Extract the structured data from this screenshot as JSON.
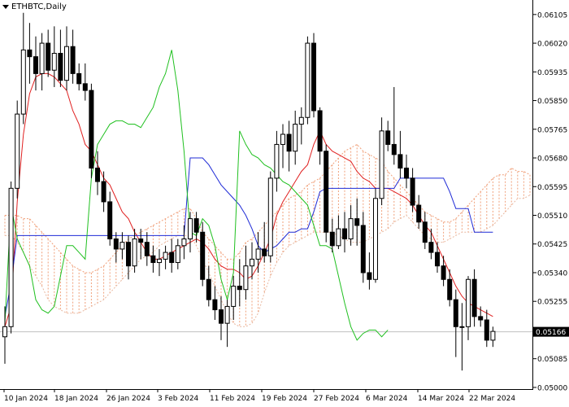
{
  "window": {
    "symbol": "ETHBTC",
    "timeframe": "Daily",
    "title": "ETHBTC,Daily",
    "menu_icon": "triangle-down-icon"
  },
  "colors": {
    "background": "#ffffff",
    "candle_up": "#ffffff",
    "candle_down": "#000000",
    "wick": "#000000",
    "tenkan": "#e02020",
    "kijun": "#1f2bd6",
    "chikou": "#20c020",
    "cloud_a": "#f0a07a",
    "cloud_b": "#e8b8a0",
    "price_line": "#c0c0c0"
  },
  "chart_data": {
    "type": "candlestick",
    "indicator": "Ichimoku Kinko Hyo",
    "y_ticks": [
      "0.06105",
      "0.06020",
      "0.05935",
      "0.05850",
      "0.05765",
      "0.05680",
      "0.05595",
      "0.05510",
      "0.05425",
      "0.05340",
      "0.05255",
      "0.05170",
      "0.05085",
      "0.05000"
    ],
    "x_ticks": [
      "10 Jan 2024",
      "18 Jan 2024",
      "26 Jan 2024",
      "3 Feb 2024",
      "11 Feb 2024",
      "19 Feb 2024",
      "27 Feb 2024",
      "6 Mar 2024",
      "14 Mar 2024",
      "22 Mar 2024"
    ],
    "ylim": [
      0.04995,
      0.06148
    ],
    "current_price": "0.05166",
    "candles": [
      [
        0.0515,
        0.0524,
        0.0507,
        0.0518
      ],
      [
        0.0518,
        0.0561,
        0.0516,
        0.0559
      ],
      [
        0.0559,
        0.0585,
        0.0556,
        0.0581
      ],
      [
        0.0581,
        0.0611,
        0.0578,
        0.06
      ],
      [
        0.06,
        0.0608,
        0.059,
        0.0598
      ],
      [
        0.0598,
        0.0604,
        0.0588,
        0.0593
      ],
      [
        0.0593,
        0.0605,
        0.0588,
        0.0602
      ],
      [
        0.0602,
        0.0606,
        0.0592,
        0.0594
      ],
      [
        0.0594,
        0.0607,
        0.0589,
        0.0599
      ],
      [
        0.0599,
        0.0606,
        0.0589,
        0.0591
      ],
      [
        0.0591,
        0.0607,
        0.0588,
        0.0601
      ],
      [
        0.0601,
        0.0606,
        0.059,
        0.0593
      ],
      [
        0.0593,
        0.0596,
        0.0588,
        0.059
      ],
      [
        0.059,
        0.0596,
        0.0585,
        0.0588
      ],
      [
        0.0588,
        0.059,
        0.0562,
        0.0565
      ],
      [
        0.0565,
        0.057,
        0.0557,
        0.0561
      ],
      [
        0.0561,
        0.0564,
        0.0552,
        0.0555
      ],
      [
        0.0555,
        0.0558,
        0.0542,
        0.0544
      ],
      [
        0.0544,
        0.0546,
        0.0537,
        0.0541
      ],
      [
        0.0541,
        0.0546,
        0.0538,
        0.0543
      ],
      [
        0.0543,
        0.0545,
        0.0532,
        0.0536
      ],
      [
        0.0536,
        0.0547,
        0.0534,
        0.0544
      ],
      [
        0.0544,
        0.0547,
        0.0538,
        0.0543
      ],
      [
        0.0543,
        0.0546,
        0.0536,
        0.0539
      ],
      [
        0.0539,
        0.0542,
        0.0534,
        0.0537
      ],
      [
        0.0537,
        0.0541,
        0.0533,
        0.0538
      ],
      [
        0.0538,
        0.0542,
        0.0535,
        0.054
      ],
      [
        0.054,
        0.0544,
        0.0534,
        0.0537
      ],
      [
        0.0537,
        0.0544,
        0.0535,
        0.0542
      ],
      [
        0.0542,
        0.0548,
        0.0538,
        0.0544
      ],
      [
        0.0544,
        0.0552,
        0.054,
        0.055
      ],
      [
        0.055,
        0.0552,
        0.0543,
        0.0546
      ],
      [
        0.0546,
        0.0549,
        0.053,
        0.0532
      ],
      [
        0.0532,
        0.0536,
        0.0524,
        0.0526
      ],
      [
        0.0526,
        0.053,
        0.052,
        0.0523
      ],
      [
        0.0523,
        0.0527,
        0.0514,
        0.0519
      ],
      [
        0.0519,
        0.0526,
        0.0512,
        0.0524
      ],
      [
        0.0524,
        0.0533,
        0.052,
        0.053
      ],
      [
        0.053,
        0.0538,
        0.0524,
        0.0529
      ],
      [
        0.0529,
        0.0542,
        0.0526,
        0.0536
      ],
      [
        0.0536,
        0.0543,
        0.0532,
        0.0538
      ],
      [
        0.0538,
        0.0546,
        0.0534,
        0.0541
      ],
      [
        0.0541,
        0.0549,
        0.0537,
        0.0539
      ],
      [
        0.0539,
        0.0564,
        0.0537,
        0.0562
      ],
      [
        0.0562,
        0.0576,
        0.0558,
        0.0572
      ],
      [
        0.0572,
        0.0578,
        0.0565,
        0.0575
      ],
      [
        0.0575,
        0.0579,
        0.0564,
        0.057
      ],
      [
        0.057,
        0.0582,
        0.0566,
        0.0578
      ],
      [
        0.0578,
        0.0583,
        0.0572,
        0.058
      ],
      [
        0.058,
        0.0604,
        0.0578,
        0.0602
      ],
      [
        0.0602,
        0.0605,
        0.058,
        0.0582
      ],
      [
        0.0582,
        0.0583,
        0.0566,
        0.057
      ],
      [
        0.057,
        0.0572,
        0.0543,
        0.0546
      ],
      [
        0.0546,
        0.055,
        0.054,
        0.0542
      ],
      [
        0.0542,
        0.0551,
        0.0541,
        0.0547
      ],
      [
        0.0547,
        0.0552,
        0.054,
        0.0544
      ],
      [
        0.0544,
        0.0554,
        0.0542,
        0.055
      ],
      [
        0.055,
        0.0556,
        0.0542,
        0.0548
      ],
      [
        0.0548,
        0.0552,
        0.0531,
        0.0534
      ],
      [
        0.0534,
        0.054,
        0.0529,
        0.0532
      ],
      [
        0.0532,
        0.0559,
        0.0531,
        0.0556
      ],
      [
        0.0556,
        0.058,
        0.0554,
        0.0576
      ],
      [
        0.0576,
        0.0579,
        0.057,
        0.0572
      ],
      [
        0.0572,
        0.0589,
        0.0566,
        0.0569
      ],
      [
        0.0569,
        0.0576,
        0.0562,
        0.0565
      ],
      [
        0.0565,
        0.0569,
        0.0559,
        0.0562
      ],
      [
        0.0562,
        0.0565,
        0.0552,
        0.0554
      ],
      [
        0.0554,
        0.0557,
        0.0547,
        0.0549
      ],
      [
        0.0549,
        0.0552,
        0.0541,
        0.0543
      ],
      [
        0.0543,
        0.0547,
        0.0538,
        0.054
      ],
      [
        0.054,
        0.0543,
        0.0534,
        0.0536
      ],
      [
        0.0536,
        0.0539,
        0.053,
        0.0532
      ],
      [
        0.0532,
        0.0535,
        0.0524,
        0.0526
      ],
      [
        0.0526,
        0.0529,
        0.0509,
        0.0518
      ],
      [
        0.0518,
        0.0525,
        0.0505,
        0.0518
      ],
      [
        0.0518,
        0.0533,
        0.0514,
        0.0532
      ],
      [
        0.0532,
        0.0535,
        0.0518,
        0.0521
      ],
      [
        0.0521,
        0.0524,
        0.0518,
        0.052
      ],
      [
        0.052,
        0.0523,
        0.0512,
        0.0514
      ],
      [
        0.0514,
        0.0518,
        0.0512,
        0.05166
      ]
    ],
    "tenkan": [
      0.0518,
      0.0524,
      0.0555,
      0.0575,
      0.0587,
      0.0592,
      0.0593,
      0.0593,
      0.0592,
      0.059,
      0.0588,
      0.0582,
      0.0578,
      0.0572,
      0.057,
      0.0566,
      0.0562,
      0.056,
      0.0556,
      0.0552,
      0.055,
      0.0546,
      0.0543,
      0.054,
      0.0538,
      0.0538,
      0.0539,
      0.054,
      0.0541,
      0.0542,
      0.0543,
      0.0544,
      0.0543,
      0.0541,
      0.0538,
      0.0536,
      0.0535,
      0.0535,
      0.0534,
      0.0532,
      0.0533,
      0.0536,
      0.054,
      0.0544,
      0.0551,
      0.0555,
      0.0558,
      0.0561,
      0.0564,
      0.0566,
      0.0572,
      0.0576,
      0.0572,
      0.057,
      0.0569,
      0.0568,
      0.0567,
      0.0564,
      0.0562,
      0.0561,
      0.0559,
      0.0559,
      0.0559,
      0.0558,
      0.0557,
      0.0556,
      0.0554,
      0.0551,
      0.0548,
      0.0546,
      0.0542,
      0.0538,
      0.0534,
      0.053,
      0.0527,
      0.0525,
      0.0524,
      0.0523,
      0.0522,
      0.0521
    ],
    "kijun": [
      0.0521,
      0.0531,
      0.0545,
      0.0545,
      0.0545,
      0.0545,
      0.0545,
      0.0545,
      0.0545,
      0.0545,
      0.0545,
      0.0545,
      0.0545,
      0.0545,
      0.0545,
      0.0545,
      0.0545,
      0.0545,
      0.0545,
      0.0545,
      0.0545,
      0.0545,
      0.0545,
      0.0545,
      0.0545,
      0.0545,
      0.0545,
      0.0545,
      0.0545,
      0.0545,
      0.0568,
      0.0568,
      0.0568,
      0.0566,
      0.0563,
      0.056,
      0.0558,
      0.0556,
      0.0554,
      0.0551,
      0.0547,
      0.0542,
      0.054,
      0.0541,
      0.0542,
      0.0544,
      0.0546,
      0.0546,
      0.0547,
      0.0547,
      0.0552,
      0.0558,
      0.0559,
      0.0559,
      0.0559,
      0.0559,
      0.0559,
      0.0559,
      0.0559,
      0.0559,
      0.0559,
      0.0559,
      0.0559,
      0.0559,
      0.0562,
      0.0562,
      0.0562,
      0.0562,
      0.0562,
      0.0562,
      0.0562,
      0.0562,
      0.0558,
      0.0553,
      0.0553,
      0.0553,
      0.0546,
      0.0546,
      0.0546,
      0.0546
    ],
    "chikou": [
      0.0519,
      0.0554,
      0.0544,
      0.054,
      0.0536,
      0.0526,
      0.0523,
      0.0522,
      0.0524,
      0.0533,
      0.0542,
      0.0542,
      0.054,
      0.0538,
      0.0562,
      0.0572,
      0.0575,
      0.0578,
      0.0579,
      0.0579,
      0.0578,
      0.0578,
      0.0577,
      0.058,
      0.0583,
      0.0589,
      0.0593,
      0.06,
      0.0588,
      0.057,
      0.0546,
      0.0545,
      0.055,
      0.0548,
      0.0542,
      0.0532,
      0.0526,
      0.0534,
      0.0576,
      0.0572,
      0.0569,
      0.0568,
      0.0566,
      0.0565,
      0.0563,
      0.0561,
      0.056,
      0.0558,
      0.0556,
      0.0554,
      0.0548,
      0.0542,
      0.0542,
      0.0541,
      0.0533,
      0.0525,
      0.0518,
      0.0514,
      0.0516,
      0.0517,
      0.0517,
      0.0515,
      0.0517
    ],
    "span_a": [
      0.0551,
      0.0551,
      0.0551,
      0.055,
      0.055,
      0.0548,
      0.0546,
      0.0544,
      0.0542,
      0.054,
      0.0538,
      0.0536,
      0.0535,
      0.0534,
      0.0534,
      0.0535,
      0.0536,
      0.0538,
      0.054,
      0.0542,
      0.0544,
      0.0545,
      0.0546,
      0.0547,
      0.0548,
      0.0549,
      0.055,
      0.0551,
      0.0552,
      0.0553,
      0.0553,
      0.055,
      0.0546,
      0.0544,
      0.0542,
      0.054,
      0.0538,
      0.0538,
      0.054,
      0.0543,
      0.0544,
      0.0546,
      0.0548,
      0.055,
      0.0552,
      0.0554,
      0.0556,
      0.0557,
      0.0558,
      0.056,
      0.0561,
      0.0562,
      0.0564,
      0.0566,
      0.0568,
      0.057,
      0.0571,
      0.0572,
      0.057,
      0.0569,
      0.0568,
      0.0567,
      0.0564,
      0.0562,
      0.056,
      0.0558,
      0.0556,
      0.0554,
      0.0552,
      0.0551,
      0.055,
      0.0549,
      0.0549,
      0.055,
      0.0552,
      0.0554,
      0.0556,
      0.0558,
      0.056,
      0.0562,
      0.0563,
      0.0563,
      0.0565,
      0.0564,
      0.0564,
      0.0563,
      0.0564,
      0.0562,
      0.0561,
      0.056,
      0.056,
      0.0559
    ],
    "span_b": [
      0.0545,
      0.0545,
      0.0543,
      0.054,
      0.0536,
      0.0533,
      0.053,
      0.0526,
      0.0524,
      0.0523,
      0.0522,
      0.0522,
      0.0522,
      0.0523,
      0.0524,
      0.0525,
      0.0526,
      0.0528,
      0.053,
      0.0532,
      0.0534,
      0.0536,
      0.0538,
      0.0539,
      0.054,
      0.0542,
      0.0543,
      0.0544,
      0.0545,
      0.0545,
      0.0545,
      0.0542,
      0.0538,
      0.0534,
      0.053,
      0.0526,
      0.0522,
      0.0519,
      0.0518,
      0.0518,
      0.0519,
      0.0522,
      0.0528,
      0.0533,
      0.0537,
      0.054,
      0.0542,
      0.0543,
      0.0544,
      0.0545,
      0.0546,
      0.0546,
      0.0546,
      0.0546,
      0.0545,
      0.0544,
      0.0543,
      0.0543,
      0.0543,
      0.0544,
      0.0545,
      0.0546,
      0.0547,
      0.0549,
      0.055,
      0.0551,
      0.0549,
      0.0547,
      0.0545,
      0.0544,
      0.0543,
      0.0543,
      0.0544,
      0.0545,
      0.0546,
      0.0546,
      0.0546,
      0.0546,
      0.0547,
      0.0548,
      0.055,
      0.0552,
      0.0554,
      0.0556,
      0.0556,
      0.0557,
      0.0558,
      0.0558,
      0.0559,
      0.0559,
      0.0559,
      0.0559
    ]
  }
}
